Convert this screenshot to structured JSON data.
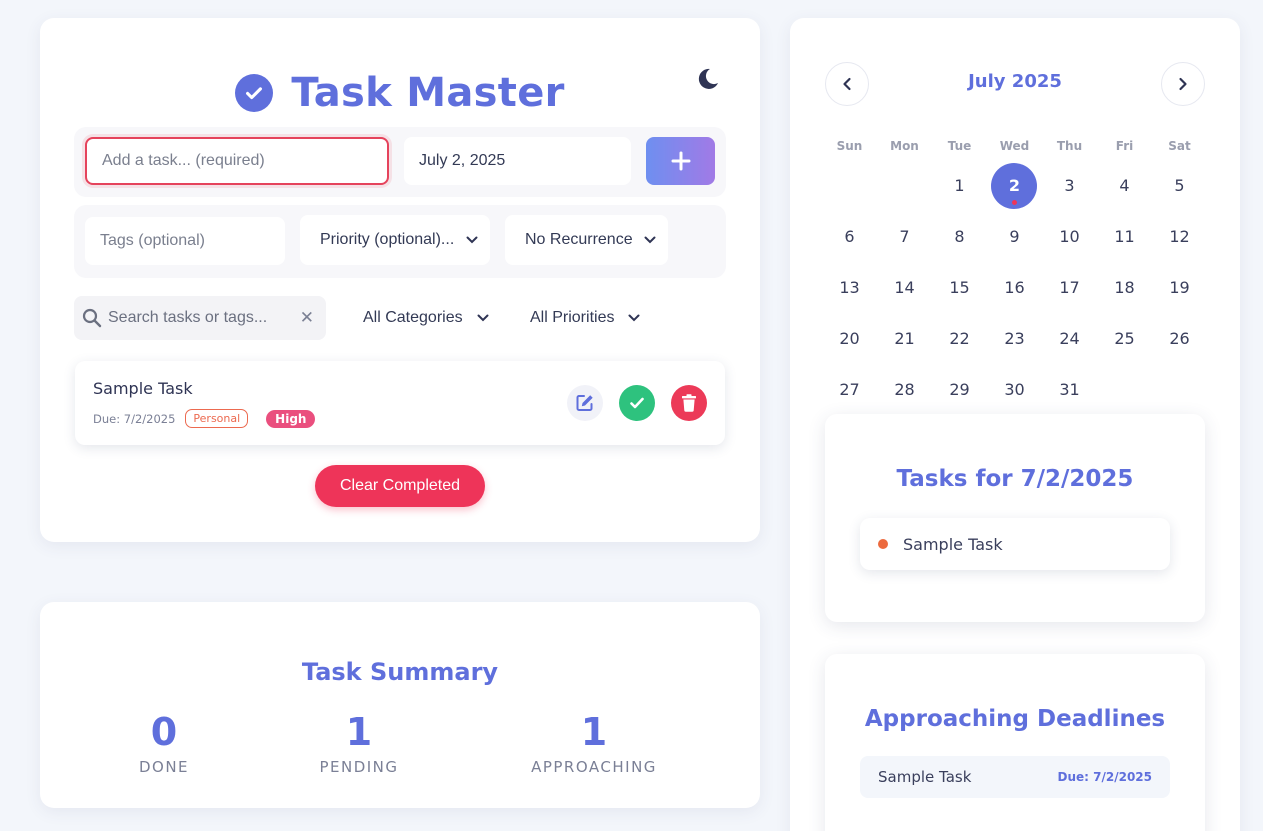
{
  "app": {
    "title": "Task Master"
  },
  "form": {
    "task_placeholder": "Add a task... (required)",
    "date_value": "July 2, 2025",
    "tags_placeholder": "Tags (optional)",
    "priority_label": "Priority (optional)...",
    "recurrence_label": "No Recurrence"
  },
  "filters": {
    "search_placeholder": "Search tasks or tags...",
    "clear_symbol": "✕",
    "category_label": "All Categories",
    "priority_label": "All Priorities"
  },
  "tasks": [
    {
      "name": "Sample Task",
      "due": "Due: 7/2/2025",
      "tag": "Personal",
      "priority": "High"
    }
  ],
  "clear_completed_label": "Clear Completed",
  "summary": {
    "title": "Task Summary",
    "done_value": "0",
    "done_label": "DONE",
    "pending_value": "1",
    "pending_label": "PENDING",
    "approaching_value": "1",
    "approaching_label": "APPROACHING"
  },
  "calendar": {
    "month_title": "July 2025",
    "weekdays": [
      "Sun",
      "Mon",
      "Tue",
      "Wed",
      "Thu",
      "Fri",
      "Sat"
    ],
    "first_weekday_index": 2,
    "days_in_month": 31,
    "selected_day": 2,
    "days_with_tasks": [
      2
    ]
  },
  "tasks_for_day": {
    "title": "Tasks for 7/2/2025",
    "items": [
      "Sample Task"
    ]
  },
  "deadlines": {
    "title": "Approaching Deadlines",
    "items": [
      {
        "name": "Sample Task",
        "due": "Due: 7/2/2025"
      }
    ]
  },
  "colors": {
    "accent": "#5f6fdc",
    "danger": "#ee3459",
    "success": "#2ec27e",
    "high_priority": "#ea4f7e",
    "personal_tag": "#ec6a50"
  },
  "icons": {
    "logo": "check-circle-icon",
    "theme": "moon-icon",
    "add": "plus-icon",
    "search": "search-icon",
    "edit": "edit-icon",
    "complete": "check-icon",
    "delete": "trash-icon",
    "prev": "chevron-left-icon",
    "next": "chevron-right-icon"
  }
}
